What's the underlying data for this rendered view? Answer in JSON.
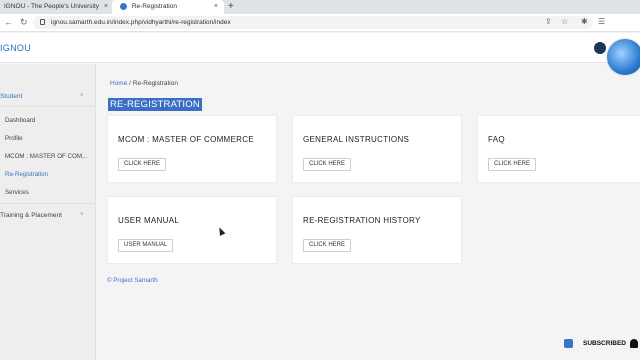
{
  "browser": {
    "tabs": [
      {
        "label": "IGNOU - The People's University",
        "close": "×"
      },
      {
        "label": "Re-Registration",
        "close": "×"
      }
    ],
    "new_tab": "+",
    "url": "ignou.samarth.edu.in/index.php/vidhyarthi/re-registration/index",
    "nav": {
      "back": "←",
      "forward": "→",
      "reload": "↻"
    },
    "icons": {
      "share": "⇪",
      "star": "☆",
      "extensions": "✱",
      "reading_list": "☰"
    }
  },
  "header": {
    "logo": "IGNOU"
  },
  "sidebar": {
    "section_student": "Student",
    "items": [
      "Dashboard",
      "Profile",
      "MCOM : MASTER OF COM...",
      "Re-Registration",
      "Services"
    ],
    "active_index": 3,
    "section_training": "Training & Placement",
    "chevron": "˄",
    "chevron_down": "˅"
  },
  "breadcrumb": {
    "home": "Home",
    "sep": "/",
    "current": "Re-Registration"
  },
  "page_title": "RE-REGISTRATION",
  "cards": [
    {
      "title": "MCOM : MASTER OF COMMERCE",
      "button": "CLICK HERE"
    },
    {
      "title": "GENERAL INSTRUCTIONS",
      "button": "CLICK HERE"
    },
    {
      "title": "FAQ",
      "button": "CLICK HERE"
    },
    {
      "title": "USER MANUAL",
      "button": "USER MANUAL"
    },
    {
      "title": "RE-REGISTRATION HISTORY",
      "button": "CLICK HERE"
    }
  ],
  "footer": "© Project Samarth",
  "overlay": {
    "subscribed": "SUBSCRIBED"
  },
  "colors": {
    "accent": "#3a74c4",
    "title_highlight": "#3a6fc4"
  }
}
